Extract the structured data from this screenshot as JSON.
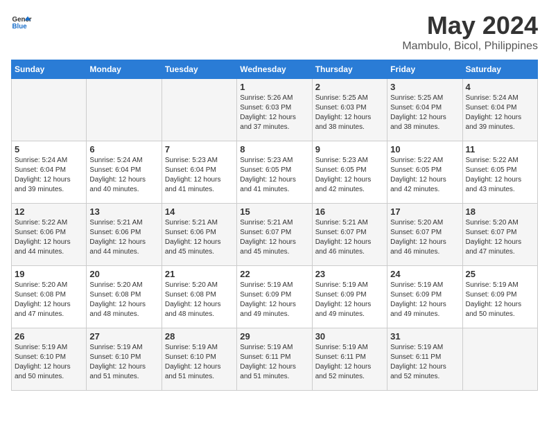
{
  "header": {
    "logo_line1": "General",
    "logo_line2": "Blue",
    "title": "May 2024",
    "subtitle": "Mambulo, Bicol, Philippines"
  },
  "weekdays": [
    "Sunday",
    "Monday",
    "Tuesday",
    "Wednesday",
    "Thursday",
    "Friday",
    "Saturday"
  ],
  "weeks": [
    [
      {
        "day": "",
        "info": ""
      },
      {
        "day": "",
        "info": ""
      },
      {
        "day": "",
        "info": ""
      },
      {
        "day": "1",
        "info": "Sunrise: 5:26 AM\nSunset: 6:03 PM\nDaylight: 12 hours\nand 37 minutes."
      },
      {
        "day": "2",
        "info": "Sunrise: 5:25 AM\nSunset: 6:03 PM\nDaylight: 12 hours\nand 38 minutes."
      },
      {
        "day": "3",
        "info": "Sunrise: 5:25 AM\nSunset: 6:04 PM\nDaylight: 12 hours\nand 38 minutes."
      },
      {
        "day": "4",
        "info": "Sunrise: 5:24 AM\nSunset: 6:04 PM\nDaylight: 12 hours\nand 39 minutes."
      }
    ],
    [
      {
        "day": "5",
        "info": "Sunrise: 5:24 AM\nSunset: 6:04 PM\nDaylight: 12 hours\nand 39 minutes."
      },
      {
        "day": "6",
        "info": "Sunrise: 5:24 AM\nSunset: 6:04 PM\nDaylight: 12 hours\nand 40 minutes."
      },
      {
        "day": "7",
        "info": "Sunrise: 5:23 AM\nSunset: 6:04 PM\nDaylight: 12 hours\nand 41 minutes."
      },
      {
        "day": "8",
        "info": "Sunrise: 5:23 AM\nSunset: 6:05 PM\nDaylight: 12 hours\nand 41 minutes."
      },
      {
        "day": "9",
        "info": "Sunrise: 5:23 AM\nSunset: 6:05 PM\nDaylight: 12 hours\nand 42 minutes."
      },
      {
        "day": "10",
        "info": "Sunrise: 5:22 AM\nSunset: 6:05 PM\nDaylight: 12 hours\nand 42 minutes."
      },
      {
        "day": "11",
        "info": "Sunrise: 5:22 AM\nSunset: 6:05 PM\nDaylight: 12 hours\nand 43 minutes."
      }
    ],
    [
      {
        "day": "12",
        "info": "Sunrise: 5:22 AM\nSunset: 6:06 PM\nDaylight: 12 hours\nand 44 minutes."
      },
      {
        "day": "13",
        "info": "Sunrise: 5:21 AM\nSunset: 6:06 PM\nDaylight: 12 hours\nand 44 minutes."
      },
      {
        "day": "14",
        "info": "Sunrise: 5:21 AM\nSunset: 6:06 PM\nDaylight: 12 hours\nand 45 minutes."
      },
      {
        "day": "15",
        "info": "Sunrise: 5:21 AM\nSunset: 6:07 PM\nDaylight: 12 hours\nand 45 minutes."
      },
      {
        "day": "16",
        "info": "Sunrise: 5:21 AM\nSunset: 6:07 PM\nDaylight: 12 hours\nand 46 minutes."
      },
      {
        "day": "17",
        "info": "Sunrise: 5:20 AM\nSunset: 6:07 PM\nDaylight: 12 hours\nand 46 minutes."
      },
      {
        "day": "18",
        "info": "Sunrise: 5:20 AM\nSunset: 6:07 PM\nDaylight: 12 hours\nand 47 minutes."
      }
    ],
    [
      {
        "day": "19",
        "info": "Sunrise: 5:20 AM\nSunset: 6:08 PM\nDaylight: 12 hours\nand 47 minutes."
      },
      {
        "day": "20",
        "info": "Sunrise: 5:20 AM\nSunset: 6:08 PM\nDaylight: 12 hours\nand 48 minutes."
      },
      {
        "day": "21",
        "info": "Sunrise: 5:20 AM\nSunset: 6:08 PM\nDaylight: 12 hours\nand 48 minutes."
      },
      {
        "day": "22",
        "info": "Sunrise: 5:19 AM\nSunset: 6:09 PM\nDaylight: 12 hours\nand 49 minutes."
      },
      {
        "day": "23",
        "info": "Sunrise: 5:19 AM\nSunset: 6:09 PM\nDaylight: 12 hours\nand 49 minutes."
      },
      {
        "day": "24",
        "info": "Sunrise: 5:19 AM\nSunset: 6:09 PM\nDaylight: 12 hours\nand 49 minutes."
      },
      {
        "day": "25",
        "info": "Sunrise: 5:19 AM\nSunset: 6:09 PM\nDaylight: 12 hours\nand 50 minutes."
      }
    ],
    [
      {
        "day": "26",
        "info": "Sunrise: 5:19 AM\nSunset: 6:10 PM\nDaylight: 12 hours\nand 50 minutes."
      },
      {
        "day": "27",
        "info": "Sunrise: 5:19 AM\nSunset: 6:10 PM\nDaylight: 12 hours\nand 51 minutes."
      },
      {
        "day": "28",
        "info": "Sunrise: 5:19 AM\nSunset: 6:10 PM\nDaylight: 12 hours\nand 51 minutes."
      },
      {
        "day": "29",
        "info": "Sunrise: 5:19 AM\nSunset: 6:11 PM\nDaylight: 12 hours\nand 51 minutes."
      },
      {
        "day": "30",
        "info": "Sunrise: 5:19 AM\nSunset: 6:11 PM\nDaylight: 12 hours\nand 52 minutes."
      },
      {
        "day": "31",
        "info": "Sunrise: 5:19 AM\nSunset: 6:11 PM\nDaylight: 12 hours\nand 52 minutes."
      },
      {
        "day": "",
        "info": ""
      }
    ]
  ]
}
